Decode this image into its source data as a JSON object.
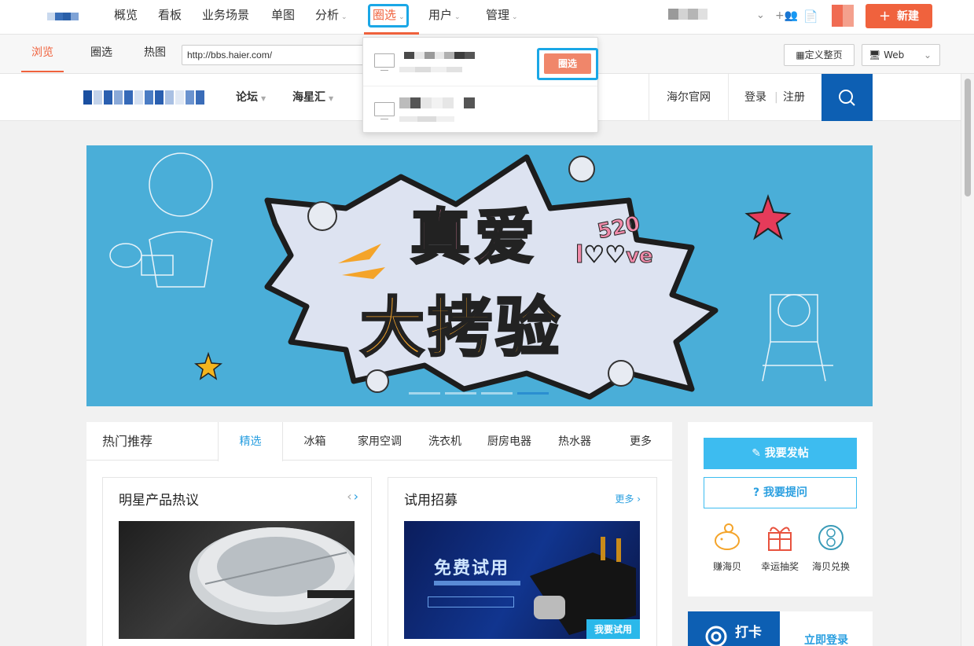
{
  "topnav": {
    "items": [
      {
        "label": "概览",
        "dropdown": false
      },
      {
        "label": "看板",
        "dropdown": false
      },
      {
        "label": "业务场景",
        "dropdown": false
      },
      {
        "label": "单图",
        "dropdown": false
      },
      {
        "label": "分析",
        "dropdown": true
      },
      {
        "label": "圈选",
        "dropdown": true,
        "active": true
      },
      {
        "label": "用户",
        "dropdown": true
      },
      {
        "label": "管理",
        "dropdown": true
      }
    ],
    "new_button": "新建",
    "new_button_icon": "plus-icon",
    "accent_color": "#f0623d"
  },
  "toolbar": {
    "tabs": [
      {
        "label": "浏览",
        "active": true
      },
      {
        "label": "圈选",
        "active": false
      },
      {
        "label": "热图",
        "active": false
      }
    ],
    "url_value": "http://bbs.haier.com/",
    "define_page_button": "定义整页",
    "platform_select": "Web"
  },
  "dropdown": {
    "select_button": "圈选"
  },
  "site": {
    "nav": [
      {
        "label": "论坛"
      },
      {
        "label": "海星汇"
      }
    ],
    "official_link": "海尔官网",
    "login": "登录",
    "register": "注册",
    "banner": {
      "line1": "真爱",
      "line2": "大拷验",
      "badge_num": "520",
      "badge_l": "l",
      "badge_ve": "ve"
    },
    "hot": {
      "title": "热门推荐",
      "tabs": [
        "精选",
        "冰箱",
        "家用空调",
        "洗衣机",
        "厨房电器",
        "热水器",
        "更多"
      ],
      "card1": {
        "title": "明星产品热议"
      },
      "card2": {
        "title": "试用招募",
        "more": "更多 ›",
        "img_title": "免费试用",
        "tag": "我要试用"
      }
    },
    "side": {
      "post": "我要发帖",
      "ask": "我要提问",
      "icons": [
        {
          "label": "赚海贝",
          "icon": "piggy-bank-icon"
        },
        {
          "label": "幸运抽奖",
          "icon": "gift-icon"
        },
        {
          "label": "海贝兑换",
          "icon": "exchange-icon"
        }
      ]
    },
    "checkin": {
      "label": "打卡",
      "login_link": "立即登录"
    }
  }
}
